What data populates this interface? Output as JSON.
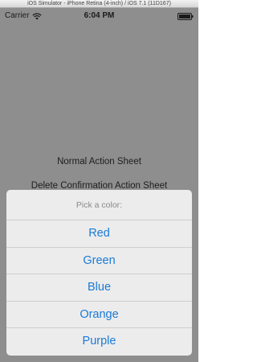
{
  "simulator": {
    "title": "iOS Simulator - iPhone Retina (4-inch) / iOS 7.1 (11D167)"
  },
  "statusbar": {
    "carrier": "Carrier",
    "time": "6:04 PM",
    "wifi_icon": "wifi-icon",
    "battery_icon": "battery-icon"
  },
  "page": {
    "normal_button": "Normal Action Sheet",
    "delete_button": "Delete Confirmation Action Sheet"
  },
  "action_sheet": {
    "title": "Pick a color:",
    "options": [
      "Red",
      "Green",
      "Blue",
      "Orange",
      "Purple"
    ],
    "option_color": "#1a7ad7"
  }
}
